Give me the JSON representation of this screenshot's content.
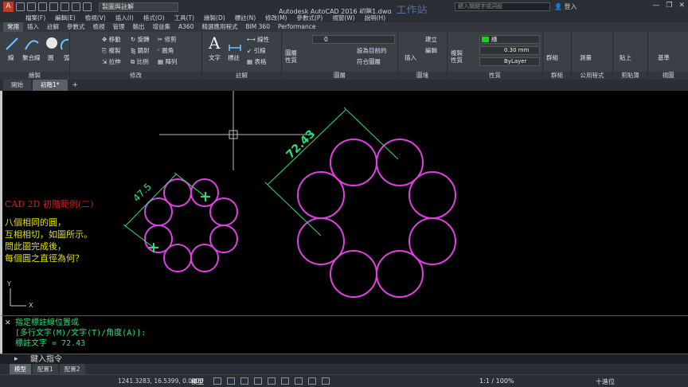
{
  "app": {
    "workspace": "製圖與註解",
    "title": "Autodesk AutoCAD 2016   初階1.dwg",
    "watermark": "工作站",
    "search_placeholder": "鍵入關鍵字或詞組",
    "login": "登入"
  },
  "menubar": [
    "檔案(F)",
    "編輯(E)",
    "檢視(V)",
    "插入(I)",
    "格式(O)",
    "工具(T)",
    "繪製(D)",
    "標註(N)",
    "修改(M)",
    "參數式(P)",
    "視窗(W)",
    "說明(H)"
  ],
  "ribbon_tabs": [
    "常用",
    "插入",
    "註解",
    "參數式",
    "檢視",
    "管理",
    "輸出",
    "增益集",
    "A360",
    "精選應用程式",
    "BIM 360",
    "Performance"
  ],
  "ribbon": {
    "draw": {
      "title": "繪製",
      "line": "線",
      "polyline": "聚合線",
      "circle": "圓",
      "arc": "弧"
    },
    "modify": {
      "title": "修改",
      "move": "移動",
      "rotate": "旋轉",
      "trim": "修剪",
      "copy": "複製",
      "mirror": "鏡射",
      "fillet": "圓角",
      "stretch": "拉伸",
      "scale": "比例",
      "array": "陣列"
    },
    "annotation": {
      "title": "註解",
      "text": "文字",
      "dimension": "標註",
      "linear": "線性",
      "leader": "引線",
      "table": "表格"
    },
    "layers": {
      "title": "圖層",
      "properties": "圖層\n性質",
      "layer_value": "0",
      "set_current": "設為目前的",
      "match": "符合圖層"
    },
    "block": {
      "title": "圖塊",
      "insert": "插入",
      "create": "建立",
      "edit": "編輯"
    },
    "properties": {
      "title": "性質",
      "match": "複製\n性質",
      "color": "綠",
      "lineweight": "0.30 mm",
      "linetype": "ByLayer"
    },
    "groups": {
      "title": "群組",
      "group": "群組"
    },
    "utilities": {
      "title": "公用程式",
      "measure": "測量"
    },
    "clipboard": {
      "title": "剪貼簿",
      "paste": "貼上"
    },
    "view": {
      "title": "視圖",
      "base": "基準"
    }
  },
  "doc_tabs": [
    "開始",
    "初階1*"
  ],
  "drawing": {
    "dim_small": "47.5",
    "dim_large": "72.43",
    "note_title": "CAD 2D 初階範例(二)",
    "note_lines": [
      "八個相同的圓，",
      "互相相切，如圖所示。",
      "問此圖完成後，",
      "每個圓之直徑為何？"
    ],
    "ucs_x": "X",
    "ucs_y": "Y"
  },
  "command": {
    "lines": [
      "指定標註線位置或",
      "[多行文字(M)/文字(T)/角度(A)]:",
      "標註文字 = 72.43"
    ],
    "input_placeholder": "鍵入指令"
  },
  "layout_tabs": [
    "模型",
    "配置1",
    "配置2"
  ],
  "status": {
    "coords": "1241.3283, 16.5399, 0.0000",
    "model": "模型",
    "scale": "1:1 / 100%",
    "units": "十進位"
  },
  "colors": {
    "circle": "#e040e0",
    "dimension": "#28e07a",
    "note_title": "#d02020",
    "note_text": "#e0e000",
    "command_text": "#28e07a"
  }
}
